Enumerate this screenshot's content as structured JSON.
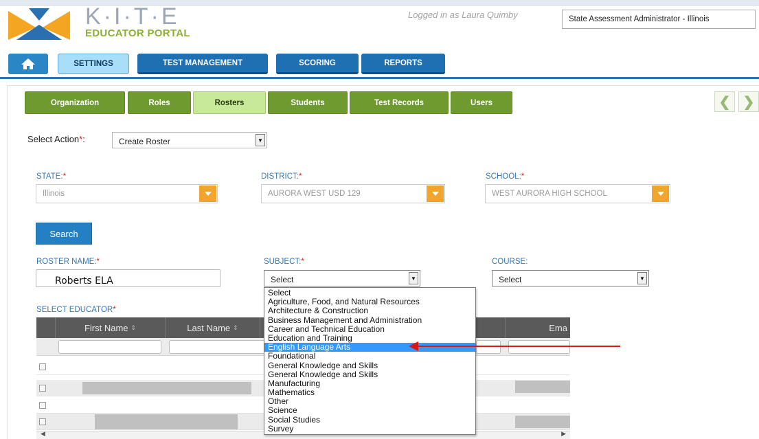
{
  "header": {
    "logo_text": "K·I·T·E",
    "logo_subtitle": "EDUCATOR PORTAL",
    "logged_in_text": "Logged in as Laura Quimby",
    "role_value": "State Assessment Administrator - Illinois"
  },
  "nav": {
    "home_icon": "home-icon",
    "tabs": [
      {
        "label": "SETTINGS",
        "active": true
      },
      {
        "label": "TEST MANAGEMENT",
        "active": false
      },
      {
        "label": "SCORING",
        "active": false
      },
      {
        "label": "REPORTS",
        "active": false
      }
    ]
  },
  "subnav": {
    "tabs": [
      {
        "label": "Organization",
        "active": false
      },
      {
        "label": "Roles",
        "active": false
      },
      {
        "label": "Rosters",
        "active": true
      },
      {
        "label": "Students",
        "active": false
      },
      {
        "label": "Test Records",
        "active": false
      },
      {
        "label": "Users",
        "active": false
      }
    ]
  },
  "action": {
    "label": "Select Action",
    "required_mark": "*",
    "colon": ":",
    "value": "Create Roster"
  },
  "filters": {
    "state": {
      "label": "STATE:",
      "required_mark": "*",
      "value": "Illinois"
    },
    "district": {
      "label": "DISTRICT:",
      "required_mark": "*",
      "value": "AURORA WEST USD 129"
    },
    "school": {
      "label": "SCHOOL:",
      "required_mark": "*",
      "value": "WEST AURORA HIGH SCHOOL"
    }
  },
  "search_button": "Search",
  "roster": {
    "roster_name": {
      "label": "ROSTER NAME:",
      "required_mark": "*",
      "value": "Roberts ELA"
    },
    "subject": {
      "label": "SUBJECT:",
      "required_mark": "*",
      "value": "Select"
    },
    "course": {
      "label": "COURSE:",
      "value": "Select"
    }
  },
  "educator": {
    "label": "SELECT EDUCATOR",
    "required_mark": "*",
    "columns": [
      "First Name",
      "Last Name",
      "Ema"
    ]
  },
  "subject_options": [
    "Select",
    "Agriculture, Food, and Natural Resources",
    "Architecture & Construction",
    "Business Management and Administration",
    "Career and Technical Education",
    "Education and Training",
    "English Language Arts",
    "Foundational",
    "General Knowledge and Skills",
    "General Knowledge and Skills",
    "Manufacturing",
    "Mathematics",
    "Other",
    "Science",
    "Social Studies",
    "Survey"
  ],
  "highlighted_option": "English Language Arts",
  "colors": {
    "nav_blue": "#1f6fb3",
    "subnav_green": "#6f9a2f",
    "accent_orange": "#f0a52c",
    "highlight_blue": "#3399ff",
    "annotation_red": "#d81818"
  }
}
